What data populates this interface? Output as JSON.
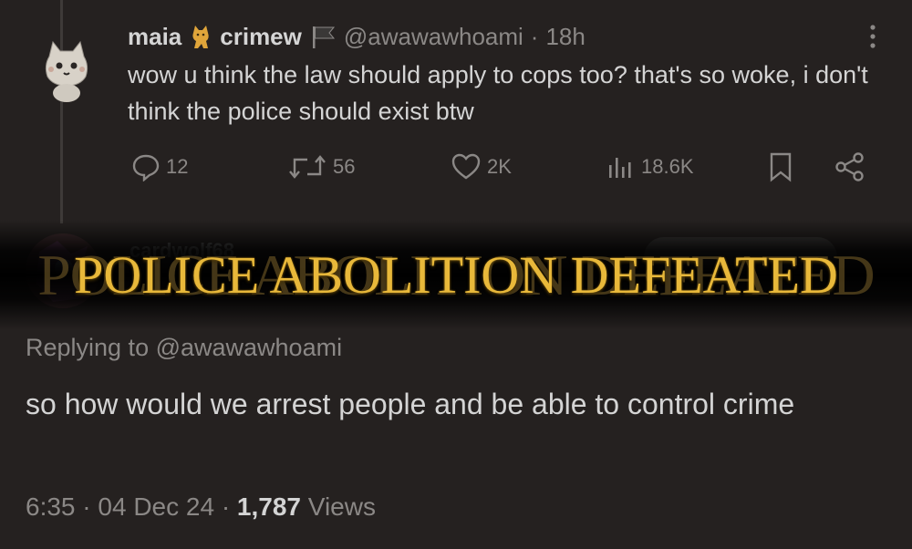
{
  "parent_tweet": {
    "author": {
      "name_part1": "maia",
      "name_part2": "crimew",
      "handle": "@awawawhoami",
      "time": "18h"
    },
    "text": "wow u think the law should apply to cops too? that's so woke, i don't think the police should exist btw",
    "actions": {
      "replies": "12",
      "reposts": "56",
      "likes": "2K",
      "views": "18.6K"
    }
  },
  "reply_author": {
    "name": "cardwolf68"
  },
  "banner": {
    "text": "POLICE ABOLITION DEFEATED",
    "color": "#e8b83a"
  },
  "reply_tweet": {
    "replying_to": "Replying to @awawawhoami",
    "text": "so how would we arrest people and be able to control crime",
    "time": "6:35",
    "date": "04 Dec 24",
    "views_count": "1,787",
    "views_label": "Views"
  },
  "icons": [
    "cat-avatar",
    "cat-emoji-icon",
    "flag-icon",
    "more-icon",
    "reply-icon",
    "repost-icon",
    "like-icon",
    "views-icon",
    "bookmark-icon",
    "share-icon"
  ]
}
